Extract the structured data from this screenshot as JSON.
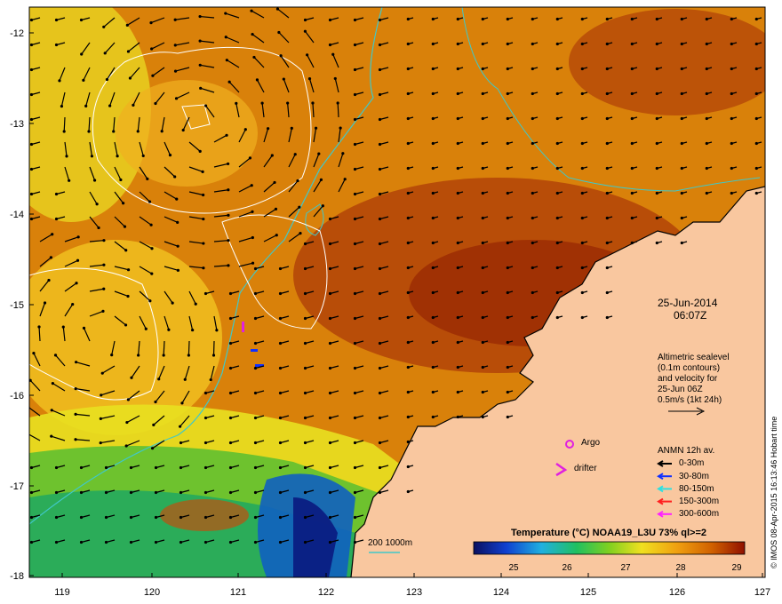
{
  "map": {
    "y_axis_labels": [
      "-12",
      "-13",
      "-14",
      "-15",
      "-16",
      "-17",
      "-18"
    ],
    "x_axis_labels": [
      "119",
      "120",
      "121",
      "122",
      "123",
      "124",
      "125",
      "126",
      "127"
    ],
    "date": "25-Jun-2014",
    "time": "06:07Z",
    "altimetry_note": [
      "Altimetric sealevel",
      "(0.1m contours)",
      "and velocity for",
      "25-Jun 06Z",
      "0.5m/s (1kt 24h)"
    ],
    "float_legend": {
      "argo": "Argo",
      "drifter": "drifter"
    },
    "anmn_title": "ANMN 12h av.",
    "anmn_depths": [
      {
        "label": "0-30m",
        "color": "#000000"
      },
      {
        "label": "30-80m",
        "color": "#1030ff"
      },
      {
        "label": "80-150m",
        "color": "#30e0e0"
      },
      {
        "label": "150-300m",
        "color": "#ff2020"
      },
      {
        "label": "300-600m",
        "color": "#ff20ff"
      }
    ],
    "bathymetry_label": "200  1000m",
    "colorbar_title": "Temperature (°C) NOAA19_L3U 73% ql>=2",
    "colorbar_ticks": [
      "25",
      "26",
      "27",
      "28",
      "29"
    ],
    "colorbar_range": [
      24.3,
      29.4
    ],
    "credit": "© IMOS 08-Apr-2015 16:13:46 Hobart time",
    "colors": {
      "land": "#f9c79f",
      "contour": "#ffffff",
      "bathymetry": "#40c8c8",
      "argo": "#e020e0",
      "drifter": "#e020e0"
    }
  }
}
